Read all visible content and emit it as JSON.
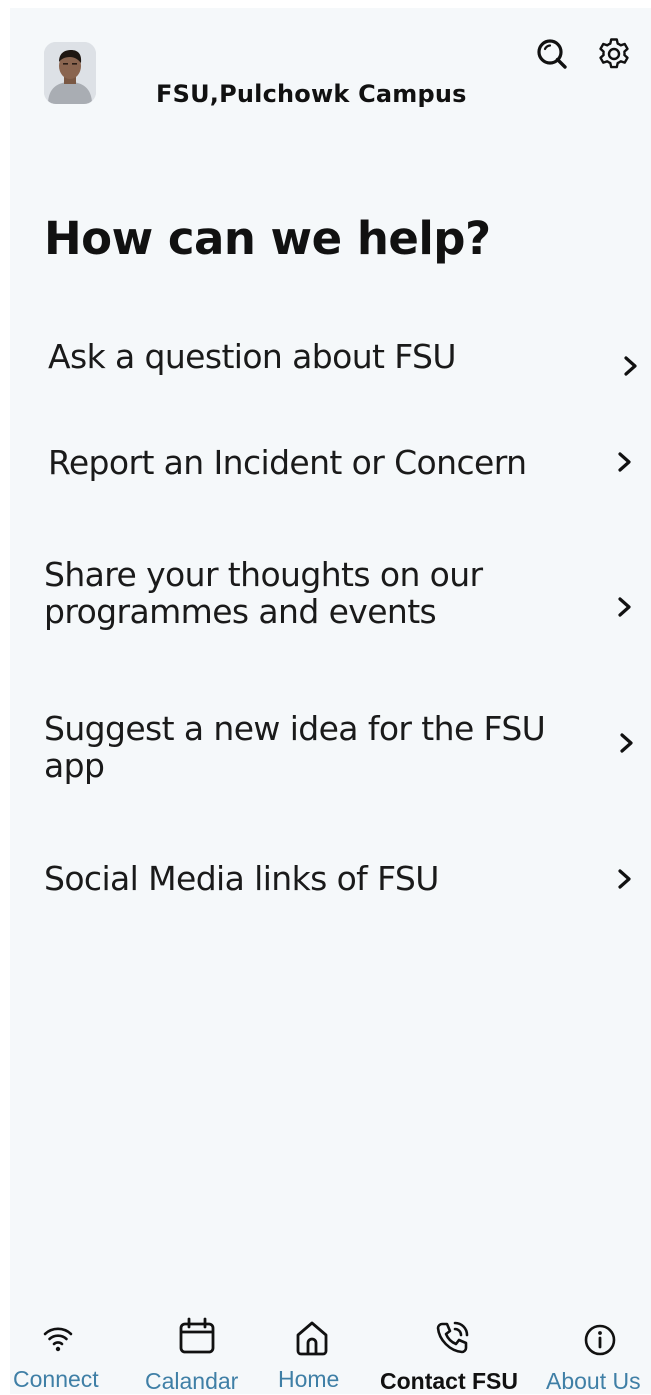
{
  "header": {
    "campus_name": "FSU,Pulchowk Campus",
    "avatar_alt": "User avatar",
    "icons": {
      "search": "search-icon",
      "settings": "gear-icon"
    }
  },
  "main": {
    "title": "How can we help?",
    "menu_items": [
      {
        "label": "Ask a question about FSU",
        "icon": "chevron-right-icon"
      },
      {
        "label": "Report an Incident or Concern",
        "icon": "chevron-right-icon"
      },
      {
        "label": "Share your thoughts on our programmes and events",
        "icon": "chevron-right-icon"
      },
      {
        "label": "Suggest a new idea for the FSU app",
        "icon": "chevron-right-icon"
      },
      {
        "label": "Social Media links of FSU",
        "icon": "chevron-right-icon"
      }
    ]
  },
  "bottom_nav": {
    "active_color": "#111111",
    "inactive_color": "#3f7fa6",
    "items": [
      {
        "label": "Connect",
        "icon": "wifi-icon",
        "active": false
      },
      {
        "label": "Calandar",
        "icon": "calendar-icon",
        "active": false
      },
      {
        "label": "Home",
        "icon": "home-icon",
        "active": false
      },
      {
        "label": "Contact FSU",
        "icon": "phone-call-icon",
        "active": true
      },
      {
        "label": "About Us",
        "icon": "info-icon",
        "active": false
      }
    ]
  }
}
